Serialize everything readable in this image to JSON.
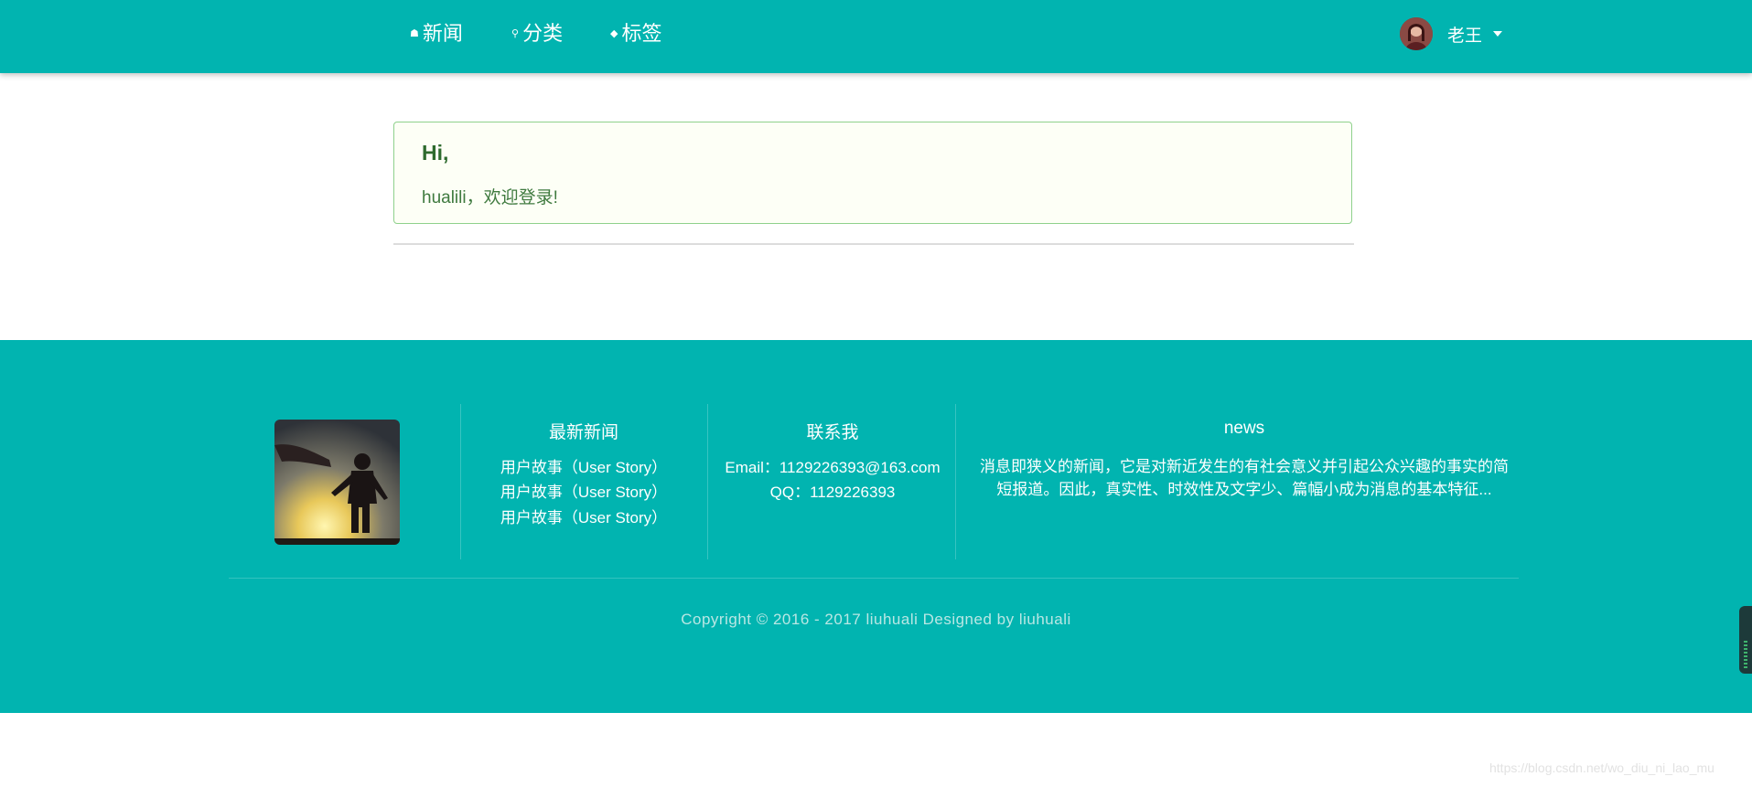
{
  "nav": {
    "items": [
      {
        "label": "新闻",
        "icon": "home-icon"
      },
      {
        "label": "分类",
        "icon": "pin-icon"
      },
      {
        "label": "标签",
        "icon": "tag-icon"
      }
    ],
    "user": {
      "name": "老王",
      "avatar": "user-avatar"
    }
  },
  "alert": {
    "title": "Hi,",
    "message": "hualili，欢迎登录!"
  },
  "footer": {
    "latest_news": {
      "title": "最新新闻",
      "links": [
        "用户故事（User Story）",
        "用户故事（User Story）",
        "用户故事（User Story）"
      ]
    },
    "contact": {
      "title": "联系我",
      "email": "Email：1129226393@163.com",
      "qq": "QQ：1129226393"
    },
    "news": {
      "title": "news",
      "description": "消息即狭义的新闻，它是对新近发生的有社会意义并引起公众兴趣的事实的简短报道。因此，真实性、时效性及文字少、篇幅小成为消息的基本特征..."
    },
    "copyright": "Copyright © 2016 - 2017 liuhuali Designed by liuhuali"
  },
  "watermark": "https://blog.csdn.net/wo_diu_ni_lao_mu",
  "colors": {
    "brand": "#01b4b0",
    "alert_border": "#8fd18c",
    "alert_bg": "#fdfff6",
    "alert_text": "#3f7a3f"
  }
}
